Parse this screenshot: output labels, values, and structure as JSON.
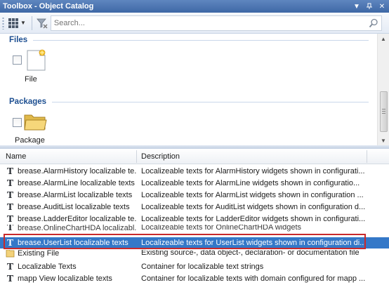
{
  "window": {
    "title": "Toolbox - Object Catalog"
  },
  "toolbar": {
    "search_placeholder": "Search...",
    "view_icon": "view-options-icon",
    "filter_icon": "filter-clear-icon",
    "search_icon": "search-icon"
  },
  "catalog": {
    "sections": [
      {
        "title": "Files",
        "items": [
          {
            "label": "File",
            "icon": "new-file-icon"
          }
        ]
      },
      {
        "title": "Packages",
        "items": [
          {
            "label": "Package",
            "icon": "folder-icon"
          }
        ]
      }
    ]
  },
  "list": {
    "columns": [
      "Name",
      "Description"
    ],
    "rows": [
      {
        "name": "brease.AlarmHistory localizable te...",
        "desc": "Localizeable texts for AlarmHistory widgets shown in configurati...",
        "icon": "text-icon"
      },
      {
        "name": "brease.AlarmLine localizable texts",
        "desc": "Localizeable texts for AlarmLine widgets shown in configuratio...",
        "icon": "text-icon"
      },
      {
        "name": "brease.AlarmList localizable texts",
        "desc": "Localizeable texts for AlarmList widgets shown in configuration ...",
        "icon": "text-icon"
      },
      {
        "name": "brease.AuditList localizable texts",
        "desc": "Localizeable texts for AuditList widgets shown in configuration d...",
        "icon": "text-icon"
      },
      {
        "name": "brease.LadderEditor localizable te...",
        "desc": "Localizeable texts for LadderEditor widgets shown in configurati...",
        "icon": "text-icon"
      },
      {
        "name": "brease.OnlineChartHDA localizabl...",
        "desc": "Localizeable texts for OnlineChartHDA widgets",
        "icon": "text-icon"
      },
      {
        "name": "brease.UserList localizable texts",
        "desc": "Localizeable texts for UserList widgets shown in configuration di...",
        "icon": "text-icon",
        "selected": true
      },
      {
        "name": "Existing File",
        "desc": "Existing source-, data object-, declaration- or documentation file",
        "icon": "existing-file-icon"
      },
      {
        "name": "Localizable Texts",
        "desc": "Container for localizable text strings",
        "icon": "text-icon"
      },
      {
        "name": "mapp View localizable texts",
        "desc": "Container for localizable texts with domain configured for mapp ...",
        "icon": "text-icon"
      }
    ]
  },
  "colors": {
    "titlebar": "#3e68a6",
    "section_title": "#1d4f91",
    "selection": "#3478c8",
    "highlight_box": "#c8292b"
  }
}
